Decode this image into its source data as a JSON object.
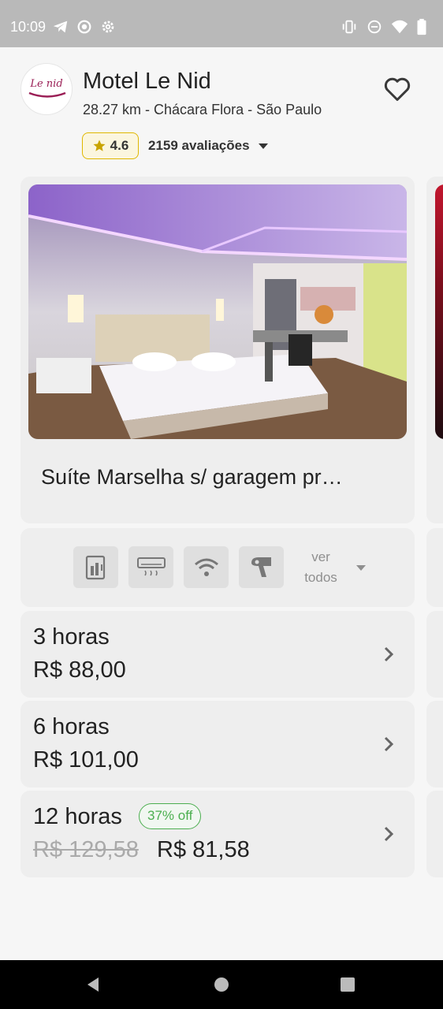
{
  "status_bar": {
    "time": "10:09",
    "left_icons": [
      "telegram-icon",
      "record-icon",
      "settings-icon"
    ],
    "right_icons": [
      "vibrate-icon",
      "do-not-disturb-icon",
      "wifi-icon",
      "battery-icon"
    ]
  },
  "header": {
    "logo_text": "Le nid",
    "title": "Motel Le Nid",
    "subtitle": "28.27 km - Chácara Flora - São Paulo",
    "rating": "4.6",
    "reviews": "2159 avaliações",
    "favorite_icon": "heart-outline-icon"
  },
  "suite": {
    "name": "Suíte Marselha s/ garagem pr…",
    "amenities": [
      {
        "icon": "frigobar-icon"
      },
      {
        "icon": "air-conditioner-icon"
      },
      {
        "icon": "wifi-icon"
      },
      {
        "icon": "hair-dryer-icon"
      }
    ],
    "see_all": "ver\ntodos"
  },
  "prices": [
    {
      "duration": "3 horas",
      "price": "R$ 88,00"
    },
    {
      "duration": "6 horas",
      "price": "R$ 101,00"
    },
    {
      "duration": "12 horas",
      "discount": "37% off",
      "old_price": "R$ 129,58",
      "price": "R$ 81,58"
    }
  ],
  "colors": {
    "status_bar": "#b9b9b9",
    "background": "#f6f6f6",
    "card": "#eeeeee",
    "rating_border": "#e0b800",
    "star": "#c9a400",
    "discount": "#4caf50",
    "logo_accent": "#9a1e55"
  },
  "nav_bar": {
    "icons": [
      "back-icon",
      "home-icon",
      "recents-icon"
    ]
  }
}
